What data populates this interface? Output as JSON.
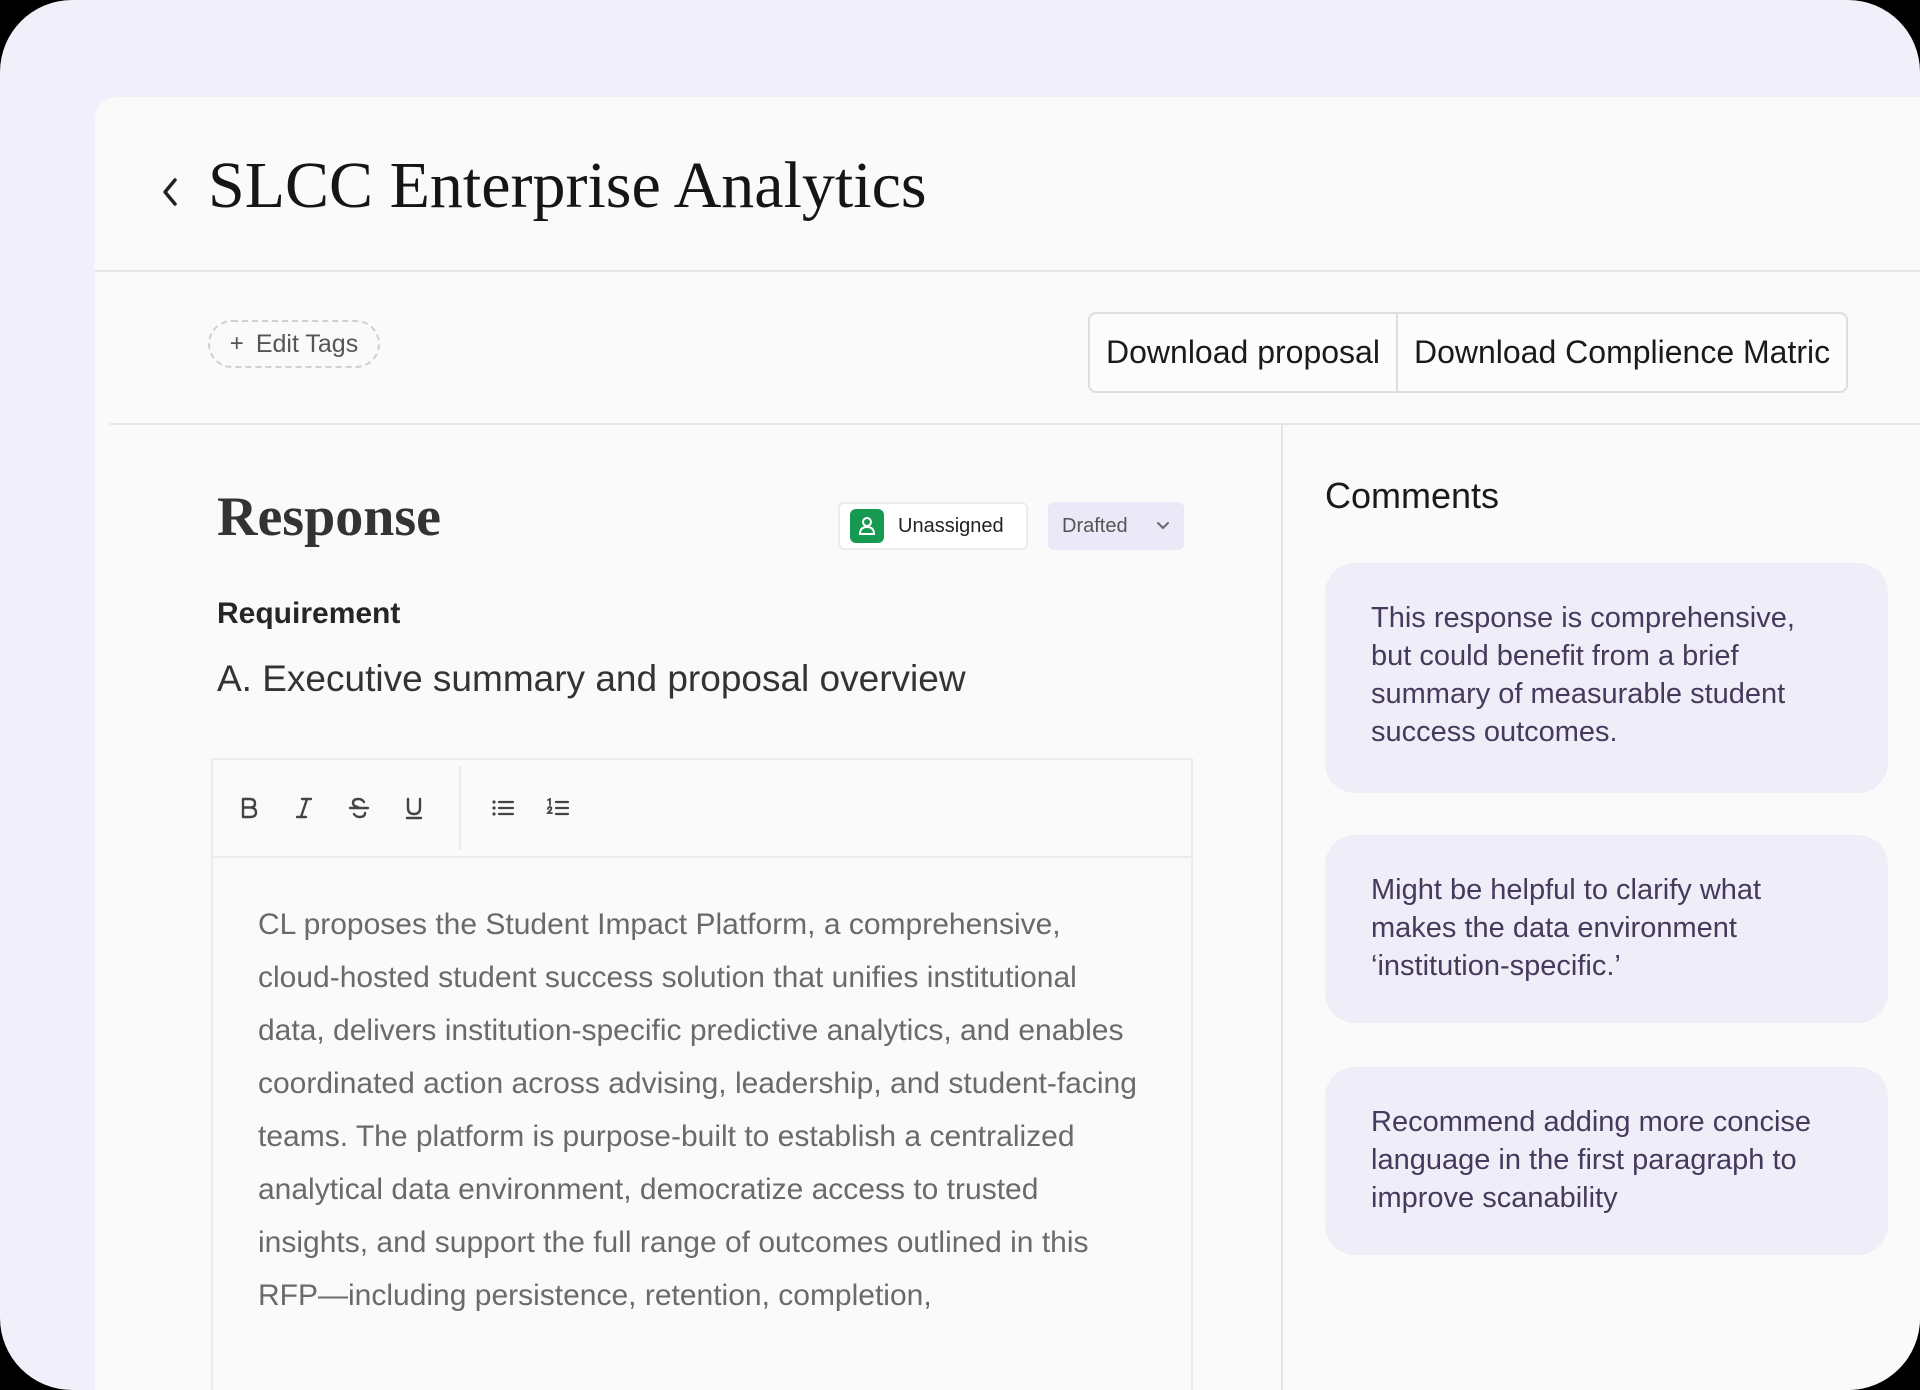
{
  "header": {
    "back_icon": "chevron-left-icon",
    "title": "SLCC Enterprise Analytics"
  },
  "actions": {
    "edit_tags_label": "Edit Tags",
    "download_proposal_label": "Download proposal",
    "download_matrix_label": "Download Complience Matric"
  },
  "response": {
    "title": "Response",
    "assignee_label": "Unassigned",
    "status_label": "Drafted",
    "requirement_label": "Requirement",
    "requirement_text": "A. Executive summary and proposal overview",
    "body": "CL proposes the Student Impact Platform, a comprehensive, cloud-hosted student success solution that unifies institutional data, delivers institution-specific predictive analytics, and enables coordinated action across advising, leadership, and student-facing teams. The platform is purpose-built to establish a centralized analytical data environment, democratize access to trusted insights, and support the full range of outcomes outlined in this RFP—including persistence, retention, completion,"
  },
  "comments": {
    "title": "Comments",
    "items": [
      {
        "text": "This response is comprehensive, but could benefit from a brief summary of measurable student success outcomes."
      },
      {
        "text": "Might be helpful to clarify what makes the data environment ‘institution-specific.’"
      },
      {
        "text": "Recommend adding more concise language in the first paragraph to improve scanability"
      }
    ]
  },
  "colors": {
    "outer_background": "#f0effa",
    "assignee_badge": "#169a52",
    "status_background": "#ebe9f8",
    "comment_background": "#efeef8",
    "comment_text": "#463a5c"
  }
}
